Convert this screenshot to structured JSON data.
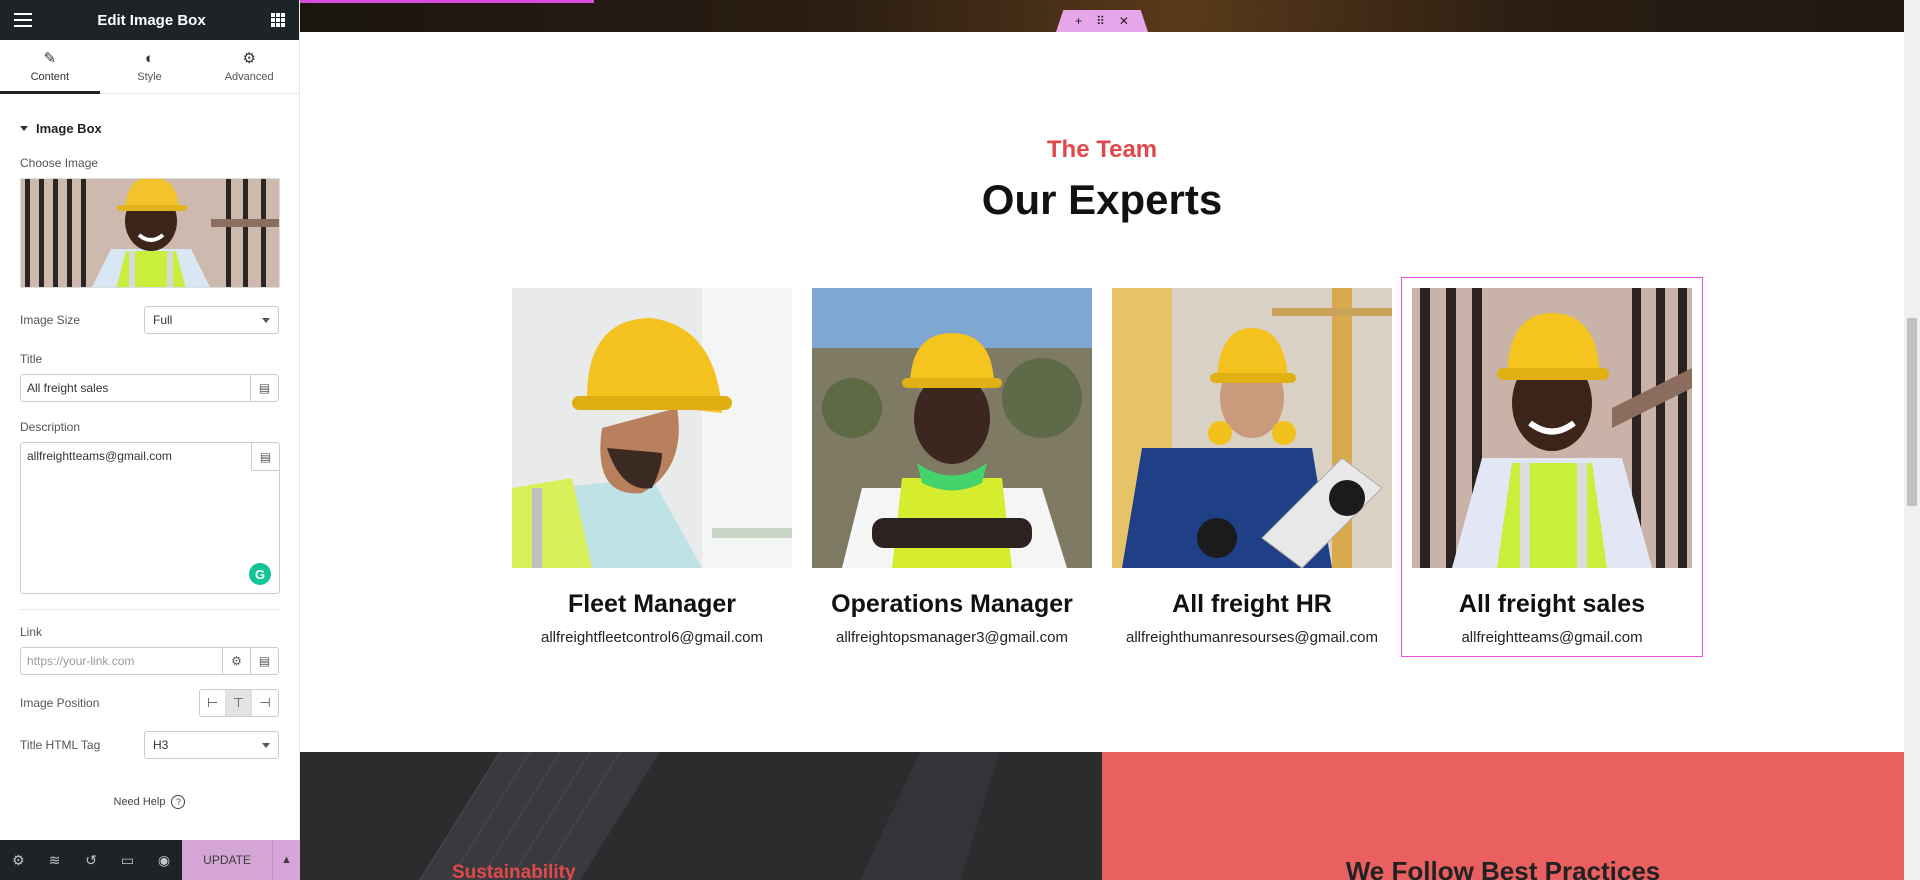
{
  "panel": {
    "title": "Edit Image Box",
    "tabs": [
      {
        "label": "Content",
        "icon": "pencil-icon"
      },
      {
        "label": "Style",
        "icon": "contrast-icon"
      },
      {
        "label": "Advanced",
        "icon": "gear-icon"
      }
    ],
    "section": "Image Box",
    "choose_image_label": "Choose Image",
    "image_size_label": "Image Size",
    "image_size_value": "Full",
    "title_label": "Title",
    "title_value": "All freight sales",
    "description_label": "Description",
    "description_value": "allfreightteams@gmail.com",
    "link_label": "Link",
    "link_placeholder": "https://your-link.com",
    "image_position_label": "Image Position",
    "title_tag_label": "Title HTML Tag",
    "title_tag_value": "H3",
    "need_help": "Need Help",
    "update_label": "UPDATE"
  },
  "preview": {
    "eyebrow": "The Team",
    "heading": "Our Experts",
    "cards": [
      {
        "title": "Fleet Manager",
        "email": "allfreightfleetcontrol6@gmail.com"
      },
      {
        "title": "Operations Manager",
        "email": "allfreightopsmanager3@gmail.com"
      },
      {
        "title": "All freight HR",
        "email": "allfreighthumanresourses@gmail.com"
      },
      {
        "title": "All freight sales",
        "email": "allfreightteams@gmail.com"
      }
    ],
    "bottom_left_heading": "Sustainability",
    "bottom_right_heading": "We Follow Best Practices"
  },
  "colors": {
    "accent_red": "#e0494a",
    "selection_pink": "#e94ee6",
    "panel_dark": "#1d2327",
    "update_button": "#d5a5d7"
  }
}
